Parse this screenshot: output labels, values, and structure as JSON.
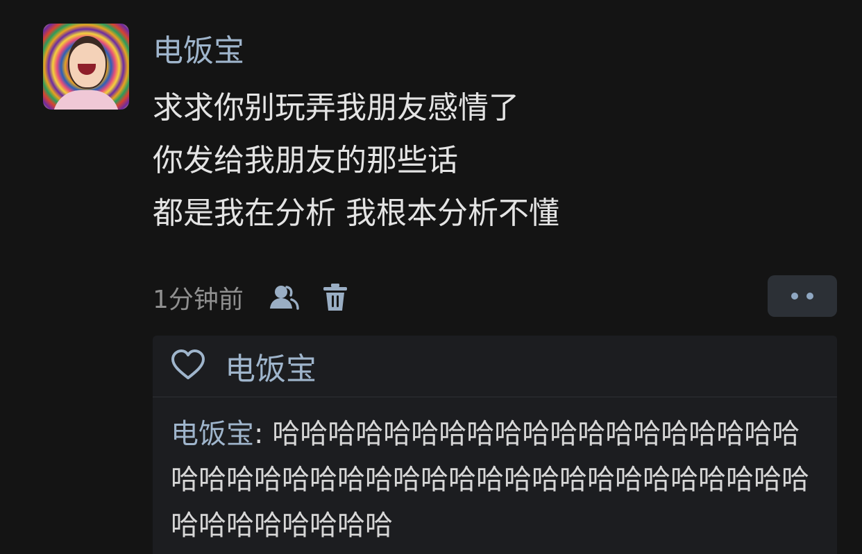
{
  "post": {
    "username": "电饭宝",
    "lines": [
      "求求你别玩弄我朋友感情了",
      "你发给我朋友的那些话",
      "都是我在分析 我根本分析不懂"
    ],
    "time": "1分钟前"
  },
  "icons": {
    "audience": "people-icon",
    "delete": "trash-icon",
    "more": "more-dots-icon",
    "like": "heart-icon"
  },
  "likes": {
    "user": "电饭宝"
  },
  "comment": {
    "author": "电饭宝",
    "separator": ": ",
    "text": "哈哈哈哈哈哈哈哈哈哈哈哈哈哈哈哈哈哈哈哈哈哈哈哈哈哈哈哈哈哈哈哈哈哈哈哈哈哈哈哈哈哈哈哈哈哈哈哈哈哈"
  },
  "colors": {
    "background": "#141414",
    "name_accent": "#9fb5cc",
    "body_text": "#e4e4e4",
    "meta_text": "#8f8f8f",
    "panel": "#1c1d20"
  }
}
